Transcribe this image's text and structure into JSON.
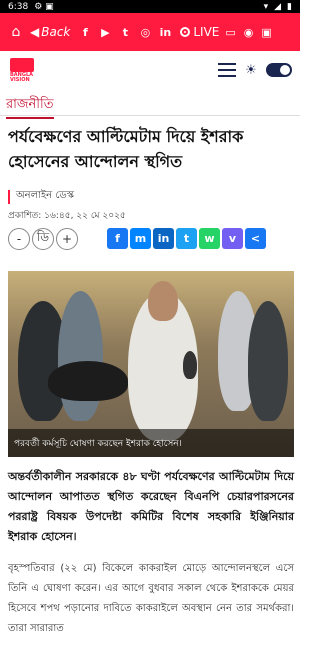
{
  "status": {
    "time": "6:38"
  },
  "topbar": {
    "back_label": "Back",
    "social": [
      "f",
      "▶",
      "t",
      "◎",
      "in"
    ],
    "live_label": "LIVE"
  },
  "logo": {
    "text": "BANGLA VISION"
  },
  "category": "রাজনীতি",
  "headline": "পর্যবেক্ষণের আল্টিমেটাম দিয়ে ইশরাক হোসেনের আন্দোলন স্থগিত",
  "author": "অনলাইন ডেস্ক",
  "dateline": "প্রকাশিত: ১৬:৪৫, ২২ মে ২০২৫",
  "font_tools": {
    "minus": "-",
    "normal": "ডি",
    "plus": "+"
  },
  "share": [
    {
      "name": "facebook",
      "glyph": "f",
      "color": "#1877f2"
    },
    {
      "name": "messenger",
      "glyph": "m",
      "color": "#0084ff"
    },
    {
      "name": "linkedin",
      "glyph": "in",
      "color": "#0a66c2"
    },
    {
      "name": "twitter",
      "glyph": "t",
      "color": "#1da1f2"
    },
    {
      "name": "whatsapp",
      "glyph": "w",
      "color": "#25d366"
    },
    {
      "name": "viber",
      "glyph": "v",
      "color": "#7360f2"
    },
    {
      "name": "share",
      "glyph": "<",
      "color": "#1877f2"
    }
  ],
  "photo_caption": "পরবর্তী কর্মসূচি ঘোষণা করছেন ইশরাক হোসেন।",
  "body_bold": "অন্তর্বর্তীকালীন সরকারকে ৪৮ ঘণ্টা পর্যবেক্ষণের আল্টিমেটাম দিয়ে আন্দোলন আপাতত স্থগিত করেছেন বিএনপি চেয়ারপারসনের পররাষ্ট্র বিষয়ক উপদেষ্টা কমিটির বিশেষ সহকারি ইঞ্জিনিয়ার ইশরাক হোসেন।",
  "body_text": "বৃহস্পতিবার (২২ মে) বিকেলে কাকরাইল মোড়ে আন্দোলনস্থলে এসে তিনি এ ঘোষণা করেন। এর আগে বুধবার সকাল থেকে ইশরাককে মেয়র হিসেবে শপথ পড়ানোর দাবিতে কাকরাইলে অবস্থান নেন তার সমর্থকরা। তারা সারারাত"
}
